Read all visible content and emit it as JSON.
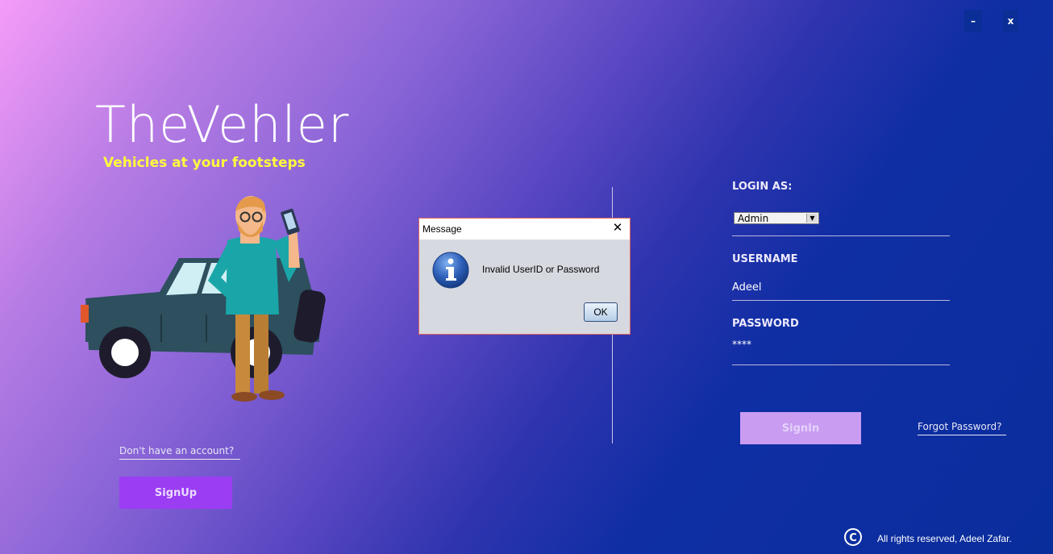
{
  "window": {
    "minimize_label": "–",
    "close_label": "x"
  },
  "brand": {
    "name": "TheVehler",
    "tagline": "Vehicles at your footsteps"
  },
  "signup": {
    "prompt": "Don't have an account?",
    "button_label": "SignUp"
  },
  "login": {
    "login_as_label": "LOGIN AS:",
    "role_selected": "Admin",
    "username_label": "USERNAME",
    "username_value": "Adeel",
    "password_label": "PASSWORD",
    "password_value": "****",
    "signin_label": "SignIn",
    "forgot_label": "Forgot Password?"
  },
  "footer": {
    "copyright_symbol": "C",
    "text": "All rights reserved, Adeel Zafar."
  },
  "dialog": {
    "title": "Message",
    "close_label": "✕",
    "icon": "info-icon",
    "message": "Invalid UserID or Password",
    "ok_label": "OK"
  },
  "colors": {
    "tagline": "#fffb3c",
    "signup_button": "#9b3df3",
    "signin_button": "#c99cf2",
    "window_button": "#0a2e96"
  }
}
